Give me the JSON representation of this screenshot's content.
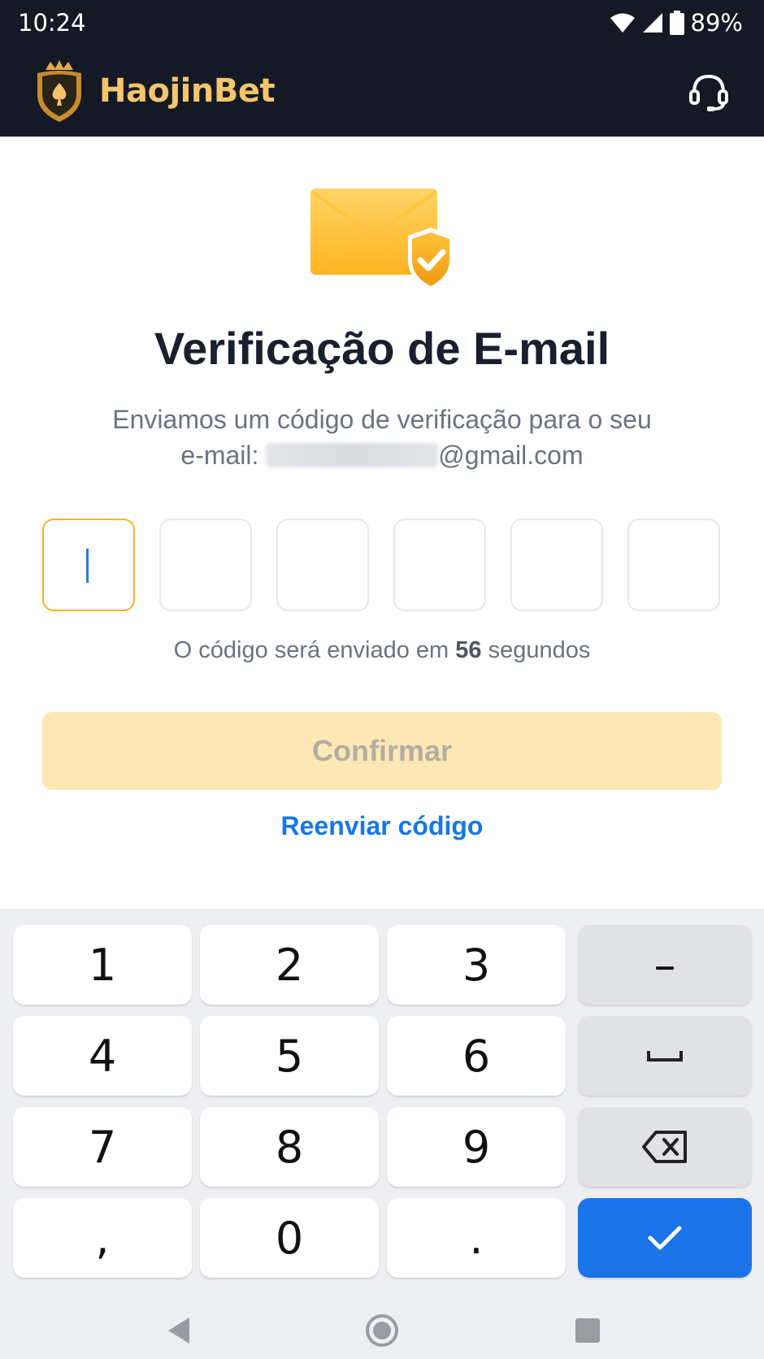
{
  "status_bar": {
    "time": "10:24",
    "battery": "89%"
  },
  "header": {
    "brand_name": "HaojinBet",
    "colors": {
      "background": "#141925",
      "brand": "#f4c56a"
    }
  },
  "verification": {
    "title": "Verificação de E-mail",
    "subtitle_line1": "Enviamos um código de verificação para o seu",
    "email_prefix": "e-mail:",
    "email_domain": "@gmail.com",
    "code_digits": [
      "",
      "",
      "",
      "",
      "",
      ""
    ],
    "timer_before": "O código será enviado em",
    "timer_seconds": "56",
    "timer_after": "segundos",
    "confirm_label": "Confirmar",
    "resend_label": "Reenviar código",
    "colors": {
      "accent": "#f4b324",
      "confirm_disabled": "#fde8b5",
      "link": "#1677e8"
    }
  },
  "keyboard": {
    "keys": [
      "1",
      "2",
      "3",
      "4",
      "5",
      "6",
      "7",
      "8",
      "9",
      ",",
      "0",
      "."
    ],
    "dash": "–",
    "space_icon": "space-icon",
    "backspace_icon": "backspace-icon",
    "done_icon": "check-icon",
    "colors": {
      "done": "#1a73e8"
    }
  },
  "nav": {
    "icons": [
      "back-icon",
      "home-icon",
      "recents-icon"
    ]
  }
}
